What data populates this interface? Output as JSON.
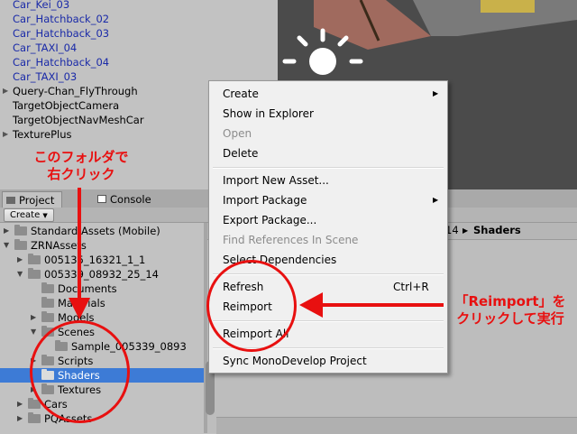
{
  "hierarchy": {
    "items": [
      {
        "label": "Car_Kei_03",
        "blue": true
      },
      {
        "label": "Car_Hatchback_02",
        "blue": true
      },
      {
        "label": "Car_Hatchback_03",
        "blue": true
      },
      {
        "label": "Car_TAXI_04",
        "blue": true
      },
      {
        "label": "Car_Hatchback_04",
        "blue": true
      },
      {
        "label": "Car_TAXI_03",
        "blue": true
      },
      {
        "label": "Query-Chan_FlyThrough",
        "blue": false
      },
      {
        "label": "TargetObjectCamera",
        "blue": false
      },
      {
        "label": "TargetObjectNavMeshCar",
        "blue": false
      },
      {
        "label": "TexturePlus",
        "blue": false
      }
    ]
  },
  "tabs": {
    "project": "Project",
    "console": "Console"
  },
  "toolbar": {
    "create": "Create"
  },
  "breadcrumb": {
    "fragment": "14",
    "current": "Shaders"
  },
  "tree": [
    {
      "label": "Standard Assets (Mobile)",
      "indent": 1,
      "arrow": "▶",
      "selected": false
    },
    {
      "label": "ZRNAssets",
      "indent": 1,
      "arrow": "▼",
      "selected": false
    },
    {
      "label": "005135_16321_1_1",
      "indent": 2,
      "arrow": "▶",
      "selected": false
    },
    {
      "label": "005339_08932_25_14",
      "indent": 2,
      "arrow": "▼",
      "selected": false
    },
    {
      "label": "Documents",
      "indent": 3,
      "arrow": "",
      "selected": false
    },
    {
      "label": "Materials",
      "indent": 3,
      "arrow": "",
      "selected": false
    },
    {
      "label": "Models",
      "indent": 3,
      "arrow": "▶",
      "selected": false
    },
    {
      "label": "Scenes",
      "indent": 3,
      "arrow": "▼",
      "selected": false
    },
    {
      "label": "Sample_005339_0893",
      "indent": 4,
      "arrow": "",
      "selected": false
    },
    {
      "label": "Scripts",
      "indent": 3,
      "arrow": "▶",
      "selected": false
    },
    {
      "label": "Shaders",
      "indent": 3,
      "arrow": "",
      "selected": true
    },
    {
      "label": "Textures",
      "indent": 3,
      "arrow": "▶",
      "selected": false
    },
    {
      "label": "Cars",
      "indent": 2,
      "arrow": "▶",
      "selected": false
    },
    {
      "label": "PQAssets",
      "indent": 2,
      "arrow": "▶",
      "selected": false
    }
  ],
  "menu": {
    "items": [
      {
        "label": "Create",
        "submenu": true
      },
      {
        "label": "Show in Explorer"
      },
      {
        "label": "Open",
        "disabled": true
      },
      {
        "label": "Delete"
      },
      {
        "label": "Import New Asset..."
      },
      {
        "label": "Import Package",
        "submenu": true
      },
      {
        "label": "Export Package..."
      },
      {
        "label": "Find References In Scene",
        "disabled": true
      },
      {
        "label": "Select Dependencies"
      },
      {
        "label": "Refresh",
        "shortcut": "Ctrl+R"
      },
      {
        "label": "Reimport"
      },
      {
        "label": "Reimport All"
      },
      {
        "label": "Sync MonoDevelop Project"
      }
    ]
  },
  "annotations": {
    "left_line1": "このフォルダで",
    "left_line2": "右クリック",
    "right_line1": "「Reimport」を",
    "right_line2": "クリックして実行",
    "color": "#e81010"
  },
  "colors": {
    "selection": "#3d7bd6",
    "annotation": "#e81010",
    "link_blue": "#1a2aa8"
  }
}
